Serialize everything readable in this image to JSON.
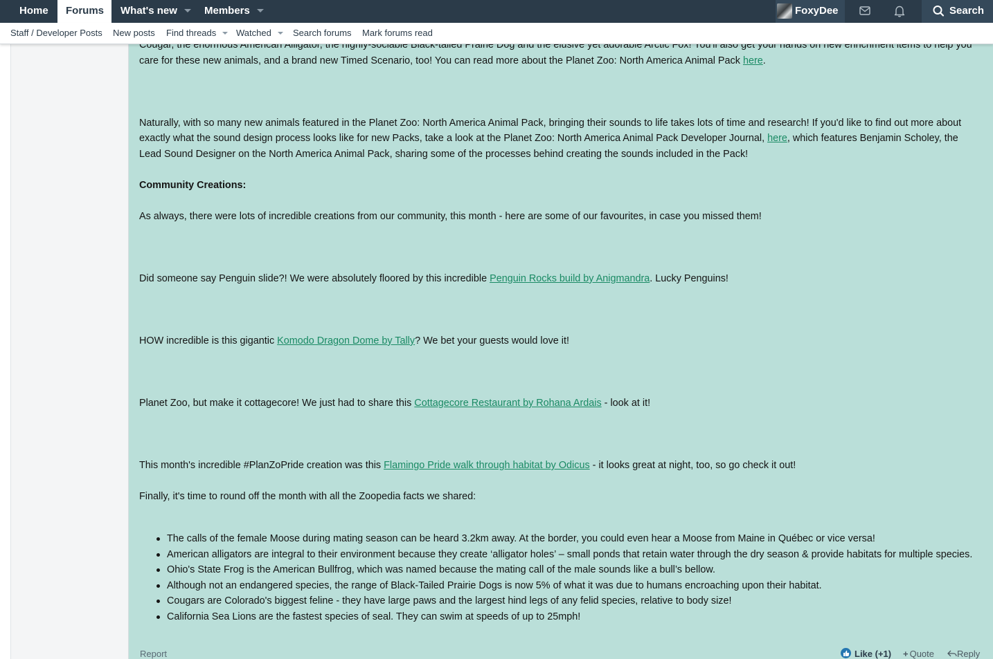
{
  "topnav": {
    "home": "Home",
    "forums": "Forums",
    "whats_new": "What's new",
    "members": "Members",
    "username": "FoxyDee",
    "search": "Search"
  },
  "subnav": {
    "staff_posts": "Staff / Developer Posts",
    "new_posts": "New posts",
    "find_threads": "Find threads",
    "watched": "Watched",
    "search_forums": "Search forums",
    "mark_read": "Mark forums read"
  },
  "post": {
    "p1_line1": "Cougar, the enormous American Alligator, the highly-sociable Black-tailed Prairie Dog and the elusive yet adorable Arctic Fox! You'll also get your hands on new enrichment items to help you",
    "p1_line2": "care for these new animals, and a brand new Timed Scenario, too! You can read more about the Planet Zoo: North America Animal Pack ",
    "p1_link": "here",
    "p1_end": ".",
    "p2_line1": "Naturally, with so many new animals featured in the Planet Zoo: North America Animal Pack, bringing their sounds to life takes lots of time and research! If you'd like to find out more about",
    "p2_line2a": "exactly what the sound design process looks like for new Packs, take a look at the Planet Zoo: North America Animal Pack Developer Journal, ",
    "p2_link": "here",
    "p2_line2b": ", which features Benjamin Scholey, the",
    "p2_line3": "Lead Sound Designer on the North America Animal Pack, sharing some of the processes behind creating the sounds included in the Pack!",
    "heading": "Community Creations:",
    "p3": "As always, there were lots of incredible creations from our community, this month - here are some of our favourites, in case you missed them!",
    "p4a": "Did someone say Penguin slide?! We were absolutely floored by this incredible ",
    "p4_link": "Penguin Rocks build by Anigmandra",
    "p4b": ". Lucky Penguins!",
    "p5a": "HOW incredible is this gigantic ",
    "p5_link": "Komodo Dragon Dome by Tally",
    "p5b": "? We bet your guests would love it!",
    "p6a": "Planet Zoo, but make it cottagecore! We just had to share this ",
    "p6_link": "Cottagecore Restaurant by Rohana Ardais",
    "p6b": " - look at it!",
    "p7a": "This month's incredible #PlanZoPride creation was this ",
    "p7_link": "Flamingo Pride walk through habitat by Odicus",
    "p7b": " - it looks great at night, too, so go check it out!",
    "p8": "Finally, it's time to round off the month with all the Zoopedia facts we shared:",
    "facts": [
      "The calls of the female Moose during mating season can be heard 3.2km away. At the border, you could even hear a Moose from Maine in Québec or vice versa!",
      "American alligators are integral to their environment because they create ‘alligator holes’ – small ponds that retain water through the dry season & provide habitats for multiple species.",
      "Ohio's State Frog is the American Bullfrog, which was named because the mating call of the male sounds like a bull’s bellow.",
      "Although not an endangered species, the range of Black-Tailed Prairie Dogs is now 5% of what it was due to humans encroaching upon their habitat.",
      "Cougars are Colorado's biggest feline - they have large paws and the largest hind legs of any felid species, relative to body size!",
      "California Sea Lions are the fastest species of seal. They can swim at speeds of up to 25mph!"
    ]
  },
  "footer": {
    "report": "Report",
    "like": "Like (+1)",
    "quote": "Quote",
    "reply": "Reply"
  },
  "colors": {
    "nav_bg": "#2b3b49",
    "post_bg": "#badfd9",
    "link": "#1a8a64"
  },
  "icons": [
    "caret-down-icon",
    "envelope-icon",
    "bell-icon",
    "search-icon",
    "thumbs-up-icon",
    "plus-icon",
    "reply-icon"
  ]
}
